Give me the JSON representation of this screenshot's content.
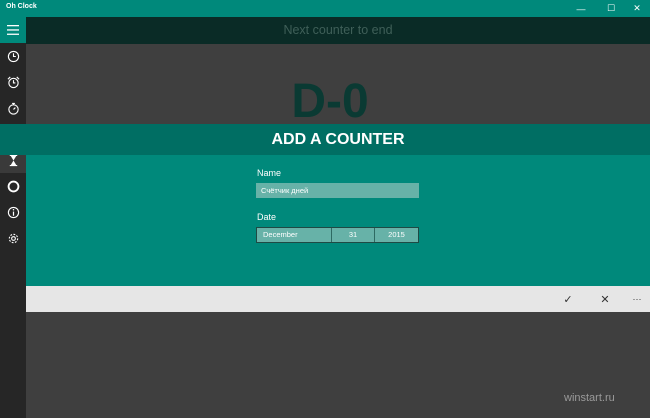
{
  "window": {
    "title": "Oh Clock",
    "minimize_glyph": "—",
    "maximize_glyph": "☐",
    "close_glyph": "✕"
  },
  "sidebar": {
    "items": [
      {
        "icon": "hamburger-icon"
      },
      {
        "icon": "clock-icon"
      },
      {
        "icon": "alarm-icon"
      },
      {
        "icon": "stopwatch-icon"
      },
      {
        "icon": "timer-icon"
      },
      {
        "icon": "hourglass-icon",
        "active": true
      },
      {
        "icon": "circle-icon"
      },
      {
        "icon": "info-icon"
      },
      {
        "icon": "gear-icon"
      }
    ]
  },
  "header": {
    "text": "Next counter to end"
  },
  "counter": {
    "value": "D-0"
  },
  "dialog": {
    "title": "ADD A COUNTER",
    "name_label": "Name",
    "name_value": "Счётчик дней",
    "date_label": "Date",
    "date": {
      "month": "December",
      "day": "31",
      "year": "2015"
    }
  },
  "commandbar": {
    "accept_glyph": "✓",
    "cancel_glyph": "✕",
    "more_glyph": "···"
  },
  "watermark": "winstart.ru",
  "colors": {
    "accent": "#00897b",
    "accent_dark": "#006e63",
    "sidebar": "#262626",
    "background": "#3f3f3f"
  }
}
